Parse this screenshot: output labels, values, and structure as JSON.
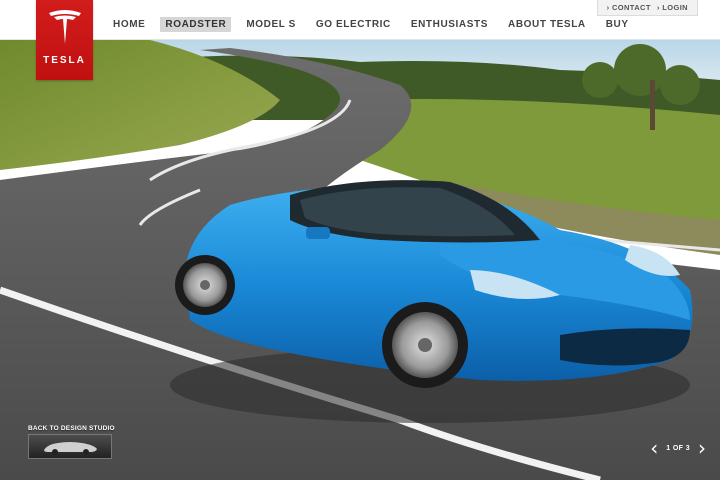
{
  "brand": {
    "logo_text": "TESLA",
    "accent": "#cc1414"
  },
  "nav": {
    "items": [
      {
        "label": "HOME"
      },
      {
        "label": "ROADSTER",
        "active": true
      },
      {
        "label": "MODEL S"
      },
      {
        "label": "GO ELECTRIC"
      },
      {
        "label": "ENTHUSIASTS"
      },
      {
        "label": "ABOUT TESLA"
      },
      {
        "label": "BUY"
      }
    ]
  },
  "utility": {
    "contact": "› CONTACT",
    "login": "› LOGIN"
  },
  "gallery": {
    "back_label": "BACK TO DESIGN STUDIO",
    "counter": "1 OF 3",
    "prev_icon": "chevron-left-icon",
    "next_icon": "chevron-right-icon"
  },
  "colors": {
    "car_body": "#1a8ad8",
    "road": "#5a5a5a",
    "grass": "#7f9a3a",
    "sky": "#cfe3ee"
  }
}
